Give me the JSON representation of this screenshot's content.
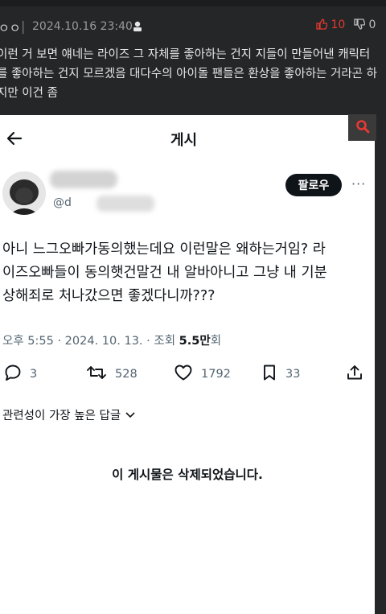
{
  "post": {
    "nickname": "ㅇㅇ",
    "separator": "|",
    "datetime": "2024.10.16 23:40",
    "upvotes": "10",
    "downvotes": "0",
    "lines": [
      "이런 거 보면 얘네는 라이즈 그 자체를 좋아하는 건지 지들이 만들어낸 캐릭터",
      "를 좋아하는 건지 모르겠음 대다수의 아이돌 팬들은 환상을 좋아하는 거라곤 하",
      "지만 이건 좀"
    ]
  },
  "screenshot": {
    "header_title": "게시",
    "handle": "@d",
    "follow_label": "팔로우",
    "more_label": "···",
    "tweet_lines": [
      "아니 느그오빠가동의했는데요 이런말은 왜하는거임? 라",
      "이즈오빠들이 동의햇건말건 내 알바아니고 그냥 내 기분",
      "상해죄로 처나갔으면 좋겠다니까???"
    ],
    "time_prefix": "오후 5:55 · 2024. 10. 13. · 조회 ",
    "views": "5.5만",
    "views_suffix": "회",
    "replies_count": "3",
    "retweets_count": "528",
    "likes_count": "1792",
    "bookmarks_count": "33",
    "replies_sort_label": "관련성이 가장 높은 답글",
    "deleted_message": "이 게시물은 삭제되었습니다."
  },
  "colors": {
    "page_bg": "#252628",
    "upvote_red": "#e23a30",
    "search_icon_red": "#e53935"
  }
}
